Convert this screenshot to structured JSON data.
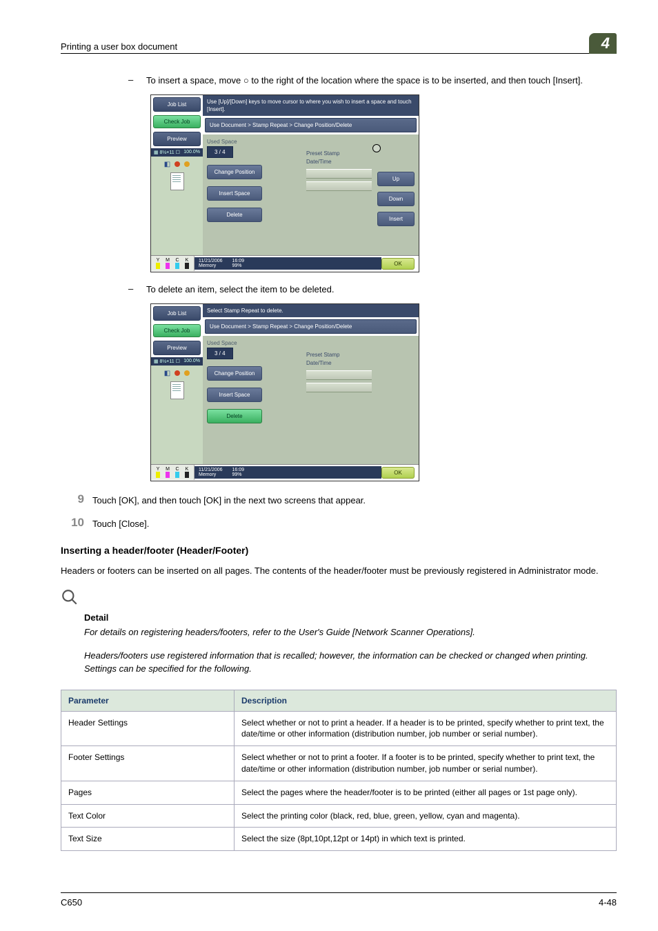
{
  "header": {
    "title": "Printing a user box document",
    "tab": "4"
  },
  "intro1": "To insert a space, move ○ to the right of the location where the space is to be inserted, and then touch [Insert].",
  "screenshot1": {
    "joblist": "Job List",
    "checkjob": "Check Job",
    "preview": "Preview",
    "pct": "100.0%",
    "topmsg": "Use [Up]/[Down] keys to move cursor to where you wish to insert a space and touch [Insert].",
    "crumb": "Use Document > Stamp Repeat > Change Position/Delete",
    "usedspace": "Used Space",
    "count": "3  /  4",
    "stamp1": "Preset Stamp",
    "stamp2": "Date/Time",
    "changepos": "Change Position",
    "insertspace": "Insert Space",
    "delete": "Delete",
    "up": "Up",
    "down": "Down",
    "insert": "Insert",
    "date": "11/21/2006",
    "time": "16:09",
    "memory": "Memory",
    "mempct": "99%",
    "ok": "OK",
    "inks": [
      "Y",
      "M",
      "C",
      "K"
    ]
  },
  "intro2": "To delete an item, select the item to be deleted.",
  "screenshot2": {
    "joblist": "Job List",
    "checkjob": "Check Job",
    "preview": "Preview",
    "pct": "100.0%",
    "topmsg": "Select Stamp Repeat to delete.",
    "crumb": "Use Document > Stamp Repeat > Change Position/Delete",
    "usedspace": "Used Space",
    "count": "3  /  4",
    "stamp1": "Preset Stamp",
    "stamp2": "Date/Time",
    "changepos": "Change Position",
    "insertspace": "Insert Space",
    "delete": "Delete",
    "date": "11/21/2006",
    "time": "16:09",
    "memory": "Memory",
    "mempct": "99%",
    "ok": "OK",
    "inks": [
      "Y",
      "M",
      "C",
      "K"
    ]
  },
  "step9": {
    "num": "9",
    "txt": "Touch [OK], and then touch [OK] in the next two screens that appear."
  },
  "step10": {
    "num": "10",
    "txt": "Touch [Close]."
  },
  "h2": "Inserting a header/footer (Header/Footer)",
  "para1": "Headers or footers can be inserted on all pages. The contents of the header/footer must be previously registered in Administrator mode.",
  "detail": {
    "head": "Detail",
    "p1": "For details on registering headers/footers, refer to the User's Guide [Network Scanner Operations].",
    "p2": "Headers/footers use registered information that is recalled; however, the information can be checked or changed when printing. Settings can be specified for the following."
  },
  "table": {
    "h1": "Parameter",
    "h2": "Description",
    "rows": [
      {
        "p": "Header Settings",
        "d": "Select whether or not to print a header. If a header is to be printed, specify whether to print text, the date/time or other information (distribution number, job number or serial number)."
      },
      {
        "p": "Footer Settings",
        "d": "Select whether or not to print a footer. If a footer is to be printed, specify whether to print text, the date/time or other information (distribution number, job number or serial number)."
      },
      {
        "p": "Pages",
        "d": "Select the pages where the header/footer is to be printed (either all pages or 1st page only)."
      },
      {
        "p": "Text Color",
        "d": "Select the printing color (black, red, blue, green, yellow, cyan and magenta)."
      },
      {
        "p": "Text Size",
        "d": "Select the size (8pt,10pt,12pt or 14pt) in which text is printed."
      }
    ]
  },
  "footer": {
    "left": "C650",
    "right": "4-48"
  }
}
